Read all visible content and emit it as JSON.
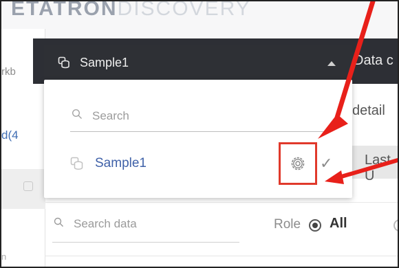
{
  "logo": {
    "part1": "ETATRON",
    "part2": "DISCOVERY"
  },
  "left": {
    "tab_text": "rkb",
    "link_text": "d(4",
    "bottom_text": "n"
  },
  "dropdown": {
    "title": "Sample1"
  },
  "header": {
    "right_label": "Data c"
  },
  "panel": {
    "search_placeholder": "Search",
    "items": [
      {
        "label": "Sample1"
      }
    ]
  },
  "content": {
    "detail_label": "detail",
    "last_button_label": "Last U",
    "search_data_placeholder": "Search data",
    "role_label": "Role",
    "role_all_label": "All"
  },
  "colors": {
    "accent": "#3f61a8",
    "dark_bar": "#2d2f35",
    "highlight_red": "#e0392b"
  },
  "icons": [
    "dataset-icon",
    "search-icon",
    "caret-up-icon",
    "gear-icon",
    "check-icon"
  ]
}
